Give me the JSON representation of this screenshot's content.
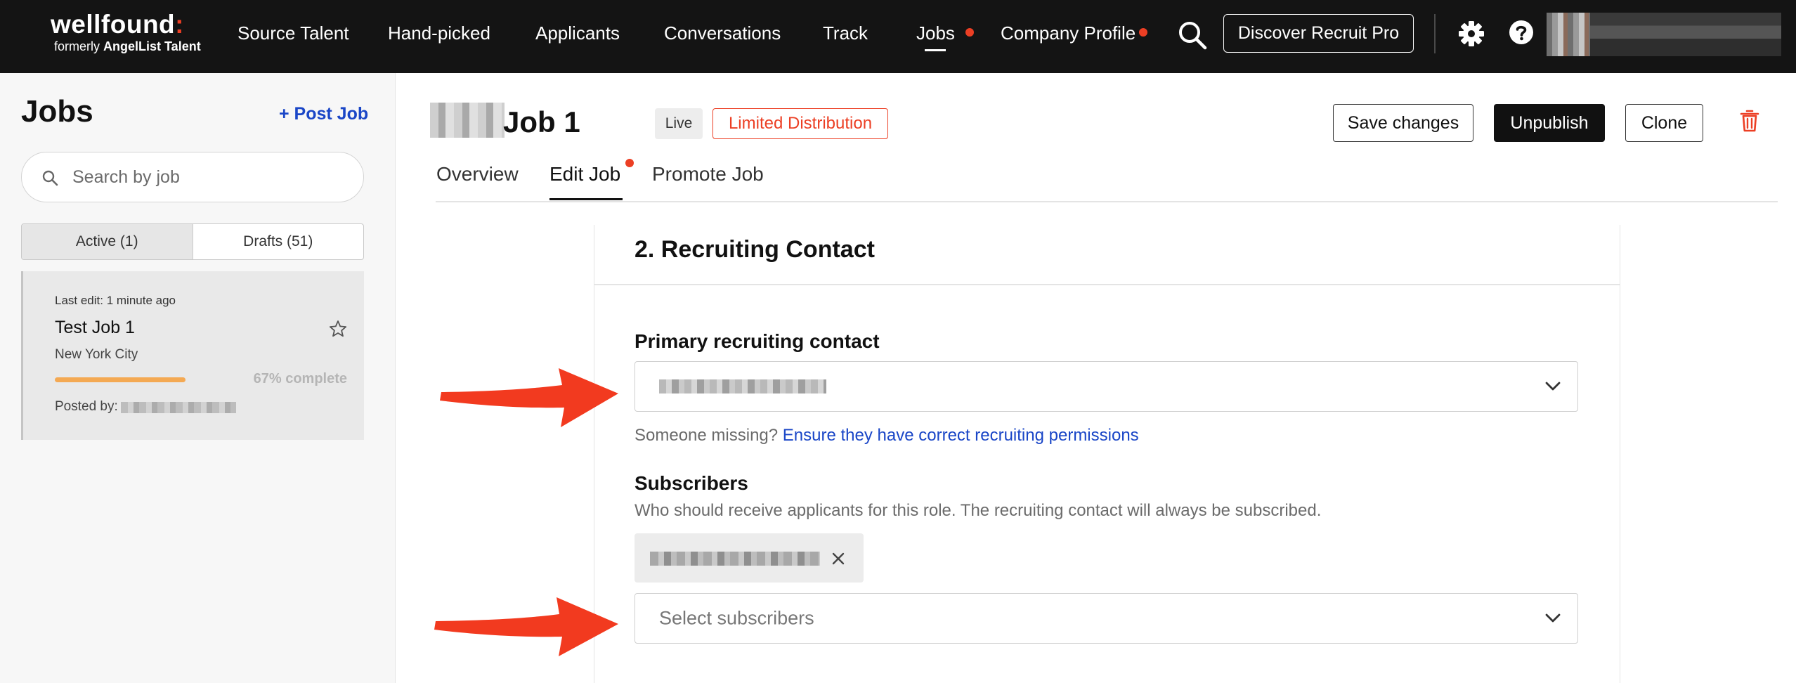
{
  "nav": {
    "logo_text": "wellfound",
    "logo_colon": ":",
    "logo_sub_prefix": "formerly ",
    "logo_sub_brand": "AngelList Talent",
    "links": [
      "Source Talent",
      "Hand-picked",
      "Applicants",
      "Conversations",
      "Track",
      "Jobs",
      "Company Profile"
    ],
    "active_link": "Jobs",
    "recruit_button": "Discover Recruit Pro",
    "icons": [
      "search-icon",
      "gear-icon",
      "help-icon"
    ],
    "notification_dot_color": "#ec3f24"
  },
  "sidebar": {
    "title": "Jobs",
    "post_job": "+ Post Job",
    "search_placeholder": "Search by job",
    "tabs": [
      {
        "label": "Active (1)",
        "active": true
      },
      {
        "label": "Drafts (51)",
        "active": false
      }
    ],
    "job_card": {
      "last_edit": "Last edit: 1 minute ago",
      "title": "Test Job 1",
      "location": "New York City",
      "progress_percent": 67,
      "complete_label": "67% complete",
      "posted_by_label": "Posted by:"
    }
  },
  "job_header": {
    "title": "Job 1",
    "status_badge": "Live",
    "distribution_badge": "Limited Distribution",
    "buttons": {
      "save": "Save changes",
      "unpublish": "Unpublish",
      "clone": "Clone"
    },
    "tabs": [
      {
        "label": "Overview",
        "active": false
      },
      {
        "label": "Edit Job",
        "active": true
      },
      {
        "label": "Promote Job",
        "active": false
      }
    ]
  },
  "form": {
    "section_title": "2. Recruiting Contact",
    "primary_label": "Primary recruiting contact",
    "missing_text": "Someone missing?",
    "missing_link": "Ensure they have correct recruiting permissions",
    "subscribers_label": "Subscribers",
    "subscribers_desc": "Who should receive applicants for this role. The recruiting contact will always be subscribed.",
    "subscribers_placeholder": "Select subscribers"
  },
  "colors": {
    "accent_blue": "#1a46c7",
    "alert_red": "#ec3f24",
    "progress_orange": "#f4a953",
    "annotation_arrow": "#f23a1f"
  }
}
